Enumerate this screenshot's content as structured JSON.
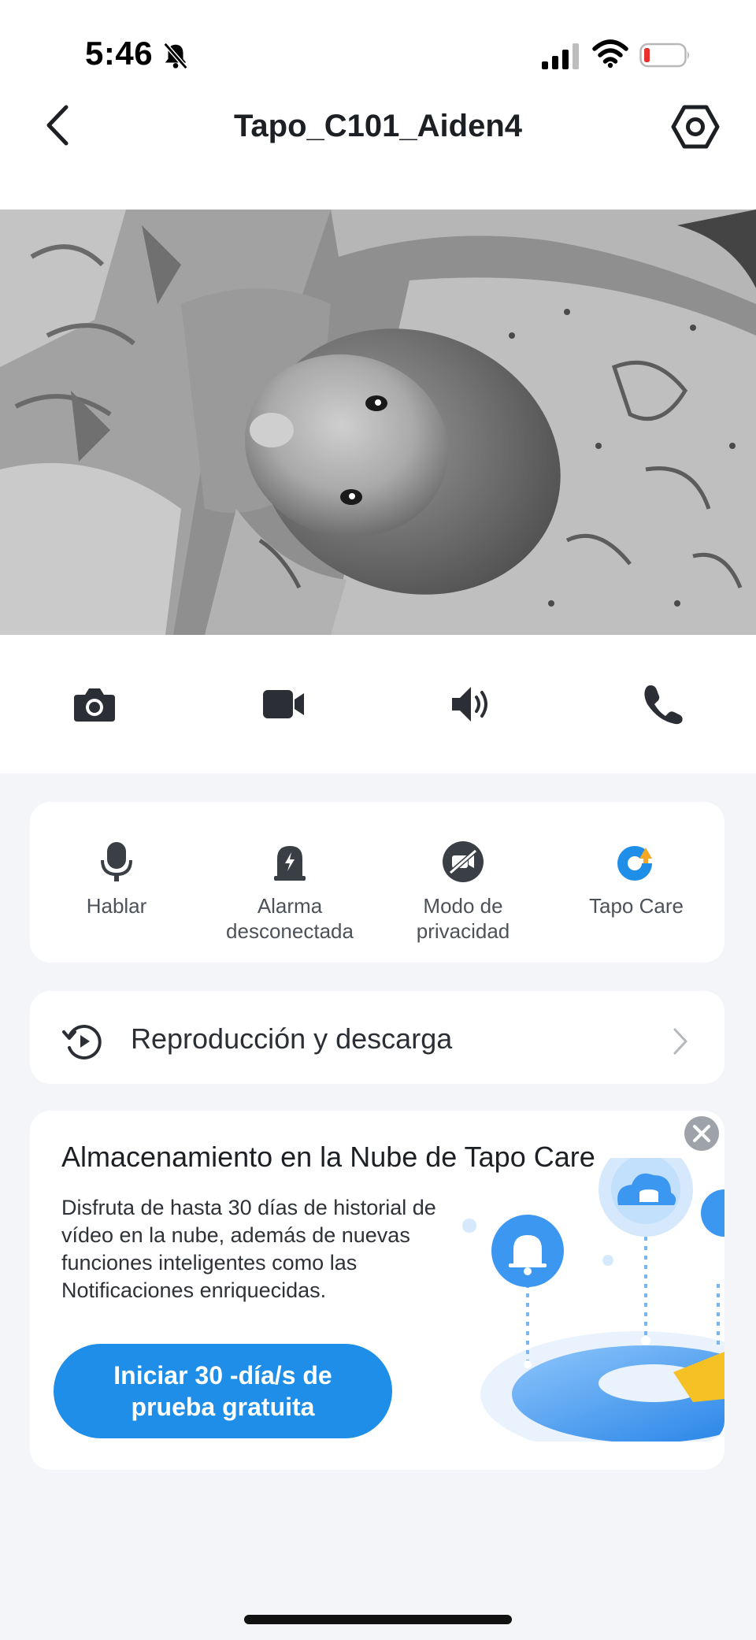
{
  "status": {
    "time": "5:46"
  },
  "header": {
    "title": "Tapo_C101_Aiden4"
  },
  "controls": [
    "camera-snapshot",
    "video-record",
    "speaker",
    "call"
  ],
  "quick_actions": [
    {
      "label": "Hablar",
      "icon": "microphone-icon"
    },
    {
      "label": "Alarma desconectada",
      "icon": "alarm-icon"
    },
    {
      "label": "Modo de privacidad",
      "icon": "privacy-icon"
    },
    {
      "label": "Tapo Care",
      "icon": "tapo-care-icon"
    }
  ],
  "playback": {
    "label": "Reproducción y descarga"
  },
  "promo": {
    "title": "Almacenamiento en la Nube de Tapo Care",
    "description": "Disfruta de hasta 30 días de historial de vídeo en la nube, además de nuevas funciones inteligentes como las Notificaciones enriquecidas.",
    "button_label": "Iniciar 30 -día/s de prueba gratuita"
  },
  "colors": {
    "accent": "#1e8ee8",
    "care_orange": "#f5a623",
    "background": "#f3f5f9"
  }
}
